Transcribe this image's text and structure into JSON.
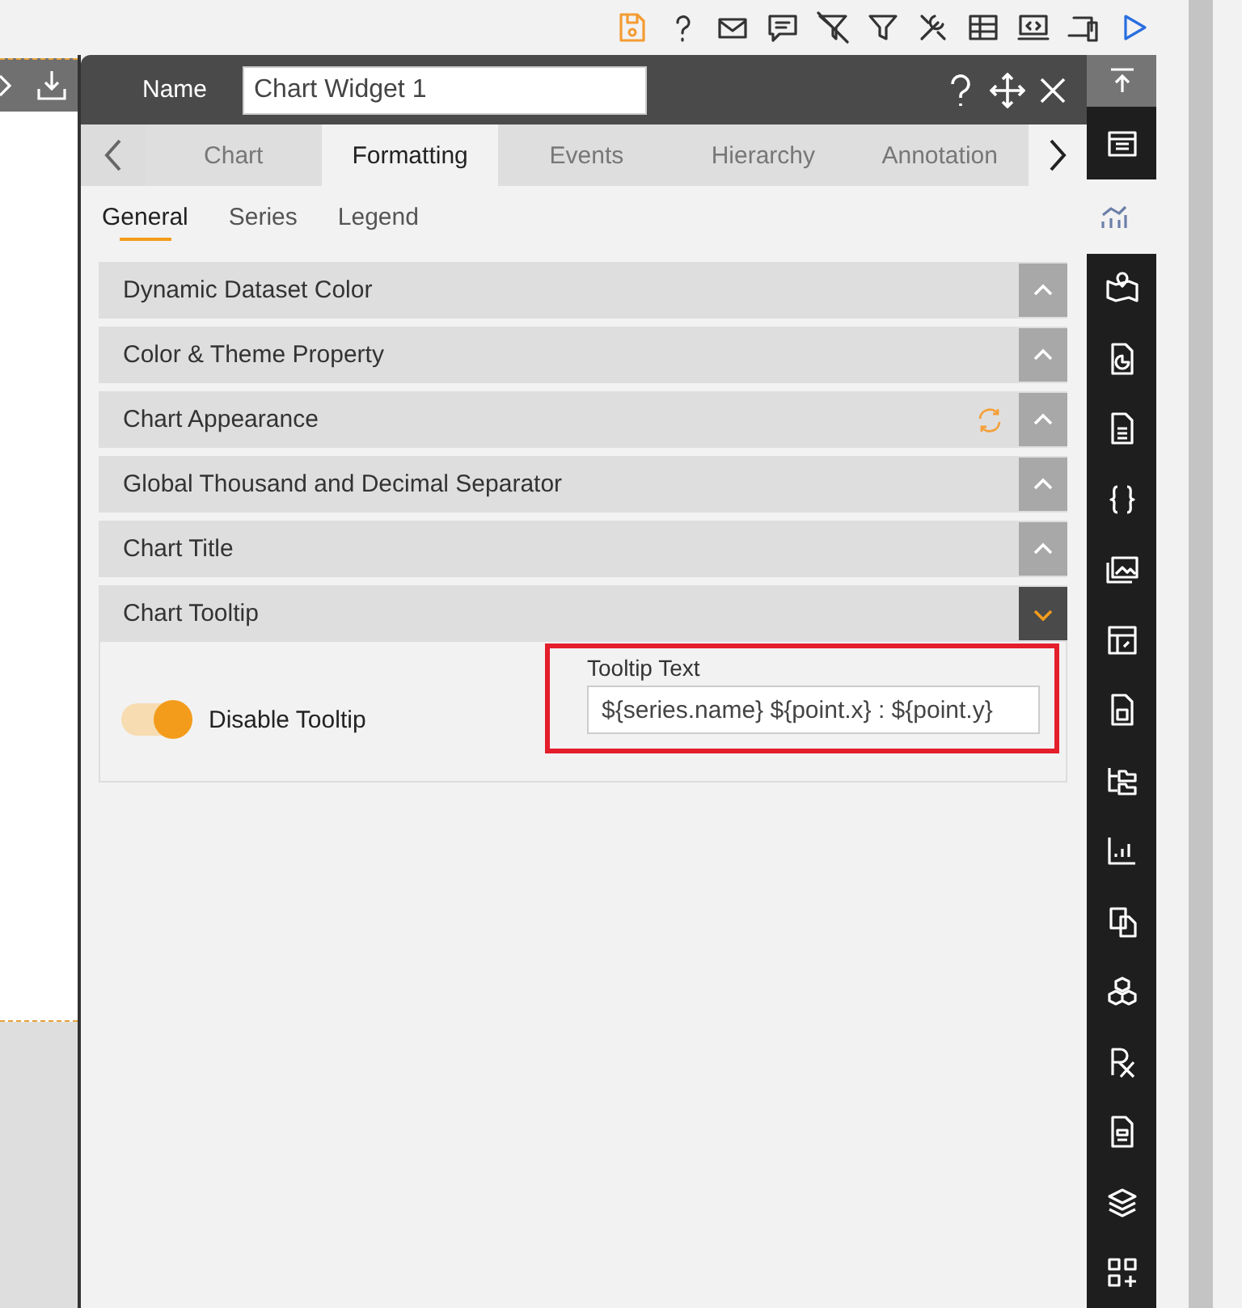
{
  "name_field": {
    "label": "Name",
    "value": "Chart Widget 1"
  },
  "tabs": [
    {
      "label": "Chart",
      "selected": false
    },
    {
      "label": "Formatting",
      "selected": true
    },
    {
      "label": "Events",
      "selected": false
    },
    {
      "label": "Hierarchy",
      "selected": false
    },
    {
      "label": "Annotation",
      "selected": false
    }
  ],
  "subtabs": [
    {
      "label": "General",
      "selected": true
    },
    {
      "label": "Series",
      "selected": false
    },
    {
      "label": "Legend",
      "selected": false
    }
  ],
  "sections": [
    {
      "title": "Dynamic Dataset Color",
      "expanded": false,
      "refresh": false
    },
    {
      "title": "Color & Theme Property",
      "expanded": false,
      "refresh": false
    },
    {
      "title": "Chart Appearance",
      "expanded": false,
      "refresh": true
    },
    {
      "title": "Global Thousand and Decimal Separator",
      "expanded": false,
      "refresh": false
    },
    {
      "title": "Chart Title",
      "expanded": false,
      "refresh": false
    },
    {
      "title": "Chart Tooltip",
      "expanded": true,
      "refresh": false
    }
  ],
  "tooltip_settings": {
    "toggle": {
      "label": "Disable Tooltip",
      "on": true
    },
    "text_field": {
      "label": "Tooltip Text",
      "value": "${series.name} ${point.x} : ${point.y}",
      "highlighted": true
    }
  },
  "rail": [
    {
      "selected": false
    },
    {
      "selected": true
    },
    {
      "selected": false
    },
    {
      "selected": false
    },
    {
      "selected": false
    },
    {
      "selected": false
    },
    {
      "selected": false
    },
    {
      "selected": false
    },
    {
      "selected": false
    },
    {
      "selected": false
    },
    {
      "selected": false
    },
    {
      "selected": false
    },
    {
      "selected": false
    },
    {
      "selected": false
    },
    {
      "selected": false
    },
    {
      "selected": false
    },
    {
      "selected": false
    }
  ]
}
